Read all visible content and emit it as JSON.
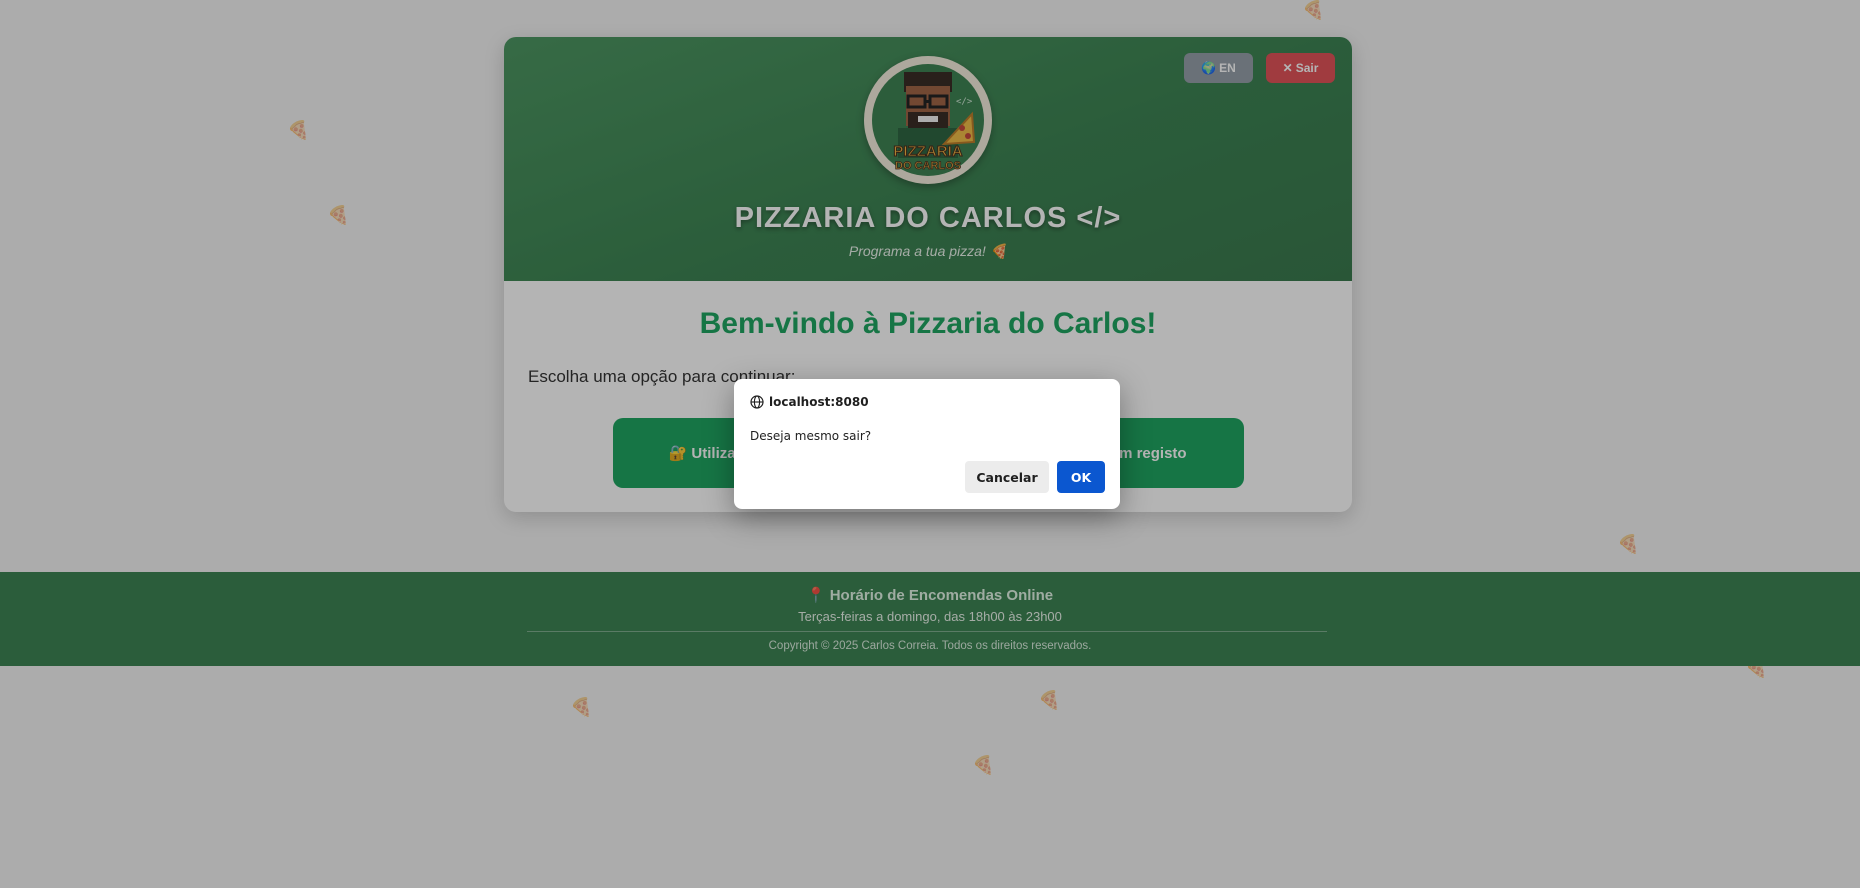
{
  "header": {
    "lang_button": "EN",
    "logout_button": "Sair",
    "logo_text_top": "PIZZARIA",
    "logo_text_bottom": "DO CARLOS",
    "title": "PIZZARIA DO CARLOS </>",
    "subtitle": "Programa a tua pizza! 🍕"
  },
  "main": {
    "welcome": "Bem-vindo à Pizzaria do Carlos!",
    "instruction": "Escolha uma opção para continuar:",
    "option_left": "🔐 Utilizador registado",
    "option_right": "Continuar sem registo"
  },
  "footer": {
    "title": "📍 Horário de Encomendas Online",
    "hours": "Terças-feiras a domingo, das 18h00 às 23h00",
    "copyright": "Copyright © 2025 Carlos Correia. Todos os direitos reservados."
  },
  "dialog": {
    "origin": "localhost:8080",
    "message": "Deseja mesmo sair?",
    "cancel": "Cancelar",
    "ok": "OK"
  },
  "colors": {
    "brand_green": "#2d7a45",
    "accent_green": "#0d9f55",
    "logout_red": "#e0464c",
    "dialog_ok_blue": "#0b57d0"
  }
}
